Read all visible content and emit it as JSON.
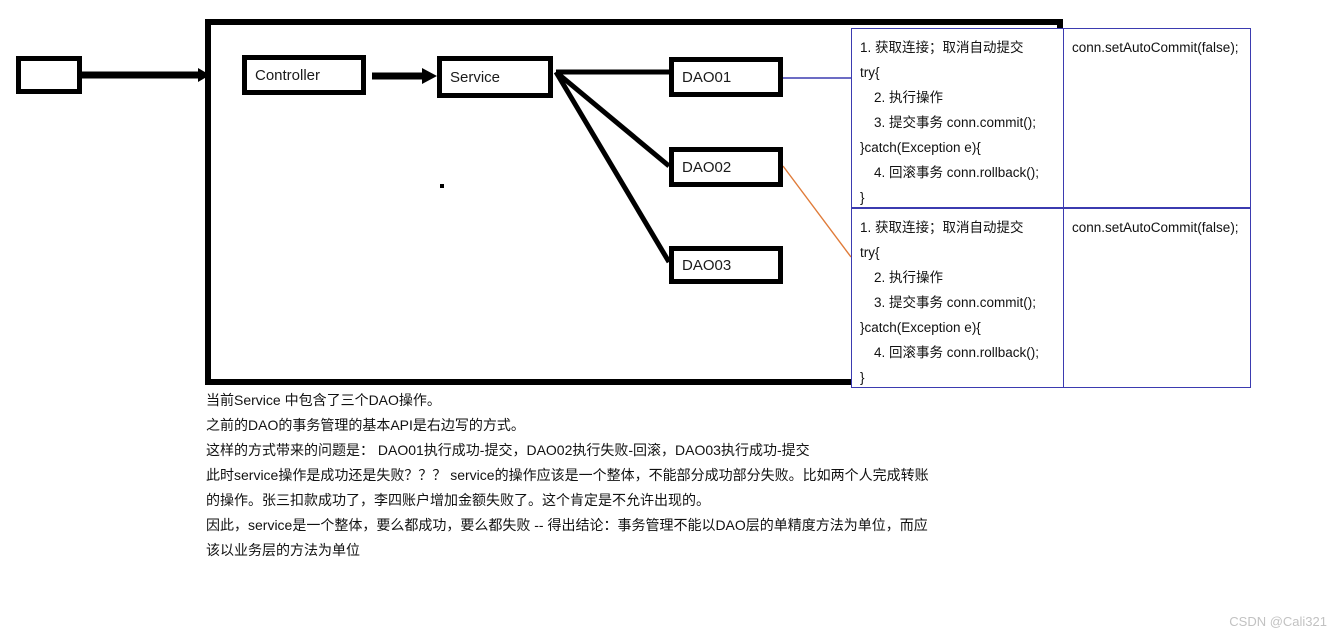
{
  "diagram": {
    "nodes": {
      "empty_box": "",
      "controller": "Controller",
      "service": "Service",
      "dao01": "DAO01",
      "dao02": "DAO02",
      "dao03": "DAO03"
    },
    "colors": {
      "node_border": "#000000",
      "table_border": "#3b3bb0",
      "link_dao01": "#3b3bb0",
      "link_dao02": "#e07b39",
      "connector": "#000000"
    }
  },
  "code_blocks": [
    {
      "left": [
        "1. 获取连接；取消自动提交",
        "try{",
        "2. 执行操作",
        "3. 提交事务    conn.commit();",
        "}catch(Exception e){",
        "4. 回滚事务    conn.rollback();",
        "}"
      ],
      "right": [
        "conn.setAutoCommit(false);"
      ]
    },
    {
      "left": [
        "1. 获取连接；取消自动提交",
        "try{",
        "2. 执行操作",
        "3. 提交事务    conn.commit();",
        "}catch(Exception e){",
        "4. 回滚事务    conn.rollback();",
        "}"
      ],
      "right": [
        "conn.setAutoCommit(false);"
      ]
    }
  ],
  "notes": [
    "当前Service 中包含了三个DAO操作。",
    "之前的DAO的事务管理的基本API是右边写的方式。",
    "这样的方式带来的问题是： DAO01执行成功-提交，DAO02执行失败-回滚，DAO03执行成功-提交",
    "此时service操作是成功还是失败？？？  service的操作应该是一个整体，不能部分成功部分失败。比如两个人完成转账",
    "的操作。张三扣款成功了，李四账户增加金额失败了。这个肯定是不允许出现的。",
    "因此，service是一个整体，要么都成功，要么都失败 -- 得出结论：事务管理不能以DAO层的单精度方法为单位，而应",
    "该以业务层的方法为单位"
  ],
  "watermark": "CSDN @Cali321"
}
